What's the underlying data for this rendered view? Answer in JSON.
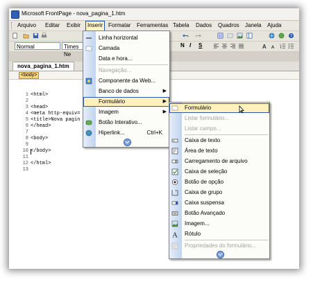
{
  "window": {
    "title": "Microsoft FrontPage - nova_pagina_1.htm"
  },
  "menubar": {
    "items": [
      "Arquivo",
      "Editar",
      "Exibir",
      "Inserir",
      "Formatar",
      "Ferramentas",
      "Tabela",
      "Dados",
      "Quadros",
      "Janela",
      "Ajuda"
    ],
    "active": "Inserir"
  },
  "formatbar": {
    "style_value": "Normal",
    "font_value": "Times Ne",
    "font_icons": [
      "N",
      "I",
      "S"
    ]
  },
  "document": {
    "tab": "nova_pagina_1.htm",
    "tag_selector": "<body>"
  },
  "code_lines": [
    {
      "n": "1",
      "text": "<html>"
    },
    {
      "n": "2",
      "text": ""
    },
    {
      "n": "3",
      "text": "<head>"
    },
    {
      "n": "4",
      "text": "<meta http-equiv="
    },
    {
      "n": "5",
      "text": "<title>Nova pagin"
    },
    {
      "n": "6",
      "text": "</head>"
    },
    {
      "n": "7",
      "text": ""
    },
    {
      "n": "8",
      "text": "<body>"
    },
    {
      "n": "9",
      "text": ""
    },
    {
      "n": "10",
      "text": "</body>"
    },
    {
      "n": "11",
      "text": ""
    },
    {
      "n": "12",
      "text": "</html>"
    },
    {
      "n": "13",
      "text": ""
    }
  ],
  "insert_menu": {
    "items": [
      {
        "label": "Linha horizontal",
        "icon": "horizontal-line-icon",
        "disabled": false
      },
      {
        "label": "Camada",
        "icon": "layer-icon",
        "disabled": false
      },
      {
        "label": "Data e hora...",
        "icon": "",
        "disabled": false
      },
      {
        "label": "Navegação...",
        "icon": "",
        "disabled": true
      },
      {
        "label": "Componente da Web...",
        "icon": "web-component-icon",
        "disabled": false
      },
      {
        "label": "Banco de dados",
        "icon": "",
        "disabled": false,
        "submenu": true
      },
      {
        "label": "Formulário",
        "icon": "",
        "disabled": false,
        "submenu": true,
        "selected": true
      },
      {
        "label": "Imagem",
        "icon": "",
        "disabled": false,
        "submenu": true
      },
      {
        "label": "Botão Interativo...",
        "icon": "interactive-button-icon",
        "disabled": false
      },
      {
        "label": "Hiperlink...",
        "icon": "hyperlink-icon",
        "disabled": false,
        "shortcut": "Ctrl+K"
      }
    ]
  },
  "form_menu": {
    "items": [
      {
        "label": "Formulário",
        "icon": "form-icon",
        "disabled": false,
        "selected": true
      },
      {
        "label": "Listar formulário...",
        "icon": "",
        "disabled": true
      },
      {
        "label": "Listar campo...",
        "icon": "",
        "disabled": true
      },
      {
        "label": "Caixa de texto",
        "icon": "textbox-icon",
        "disabled": false
      },
      {
        "label": "Área de texto",
        "icon": "textarea-icon",
        "disabled": false
      },
      {
        "label": "Carregamento de arquivo",
        "icon": "file-upload-icon",
        "disabled": false
      },
      {
        "label": "Caixa de seleção",
        "icon": "checkbox-icon",
        "disabled": false
      },
      {
        "label": "Botão de opção",
        "icon": "radio-button-icon",
        "disabled": false
      },
      {
        "label": "Caixa de grupo",
        "icon": "groupbox-icon",
        "disabled": false
      },
      {
        "label": "Caixa suspensa",
        "icon": "dropdown-icon",
        "disabled": false
      },
      {
        "label": "Botão Avançado",
        "icon": "advanced-button-icon",
        "disabled": false
      },
      {
        "label": "Imagem...",
        "icon": "image-icon",
        "disabled": false
      },
      {
        "label": "Rótulo",
        "icon": "label-icon",
        "disabled": false
      },
      {
        "label": "Propriedades do formulário...",
        "icon": "form-properties-icon",
        "disabled": true
      }
    ]
  }
}
